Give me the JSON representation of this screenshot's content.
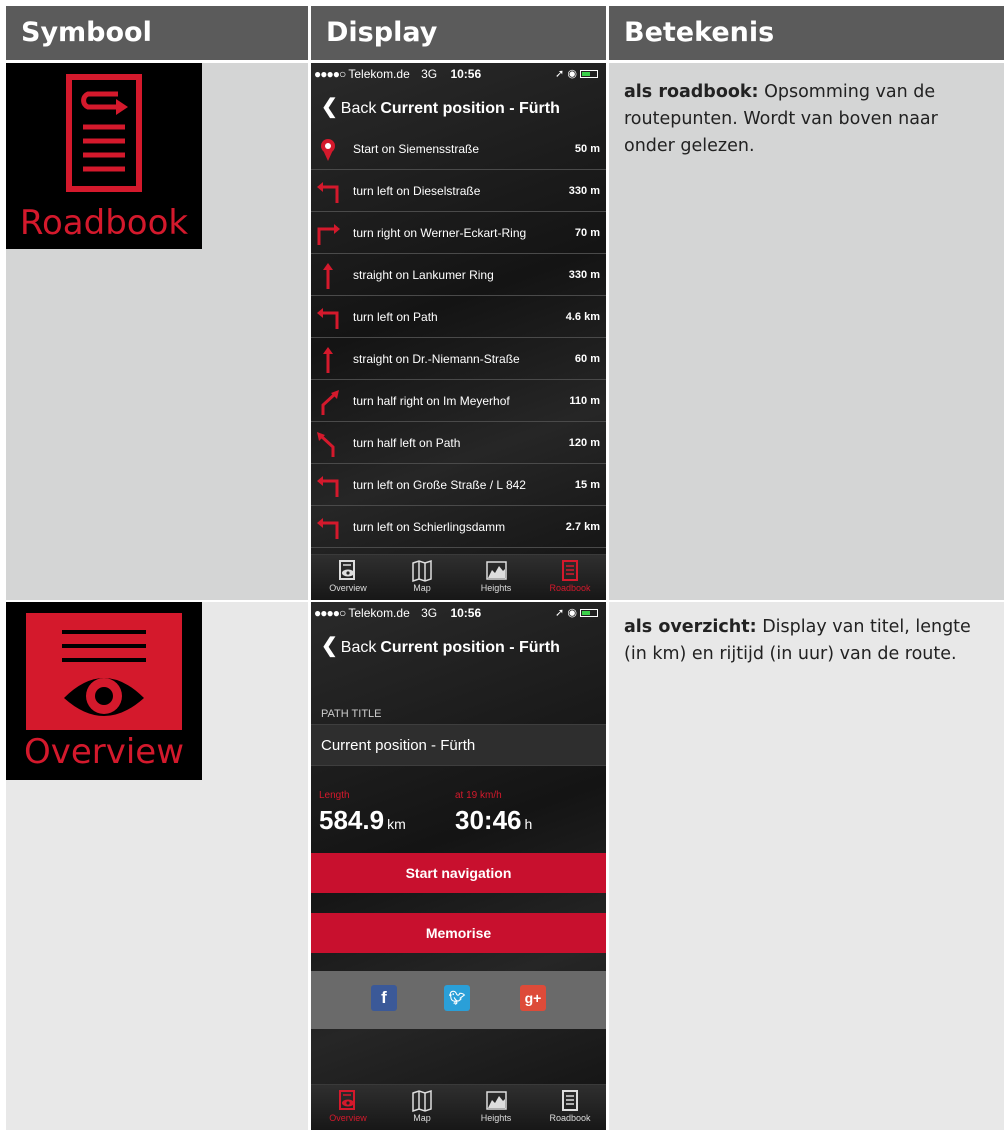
{
  "header": {
    "col1": "Symbool",
    "col2": "Display",
    "col3": "Betekenis"
  },
  "colors": {
    "accent": "#d4192c",
    "header_bg": "#5b5b5b"
  },
  "rows": [
    {
      "symbol_label": "Roadbook",
      "symbol_icon": "roadbook-icon",
      "desc_bold": "als roadbook:",
      "desc_text": " Opsomming van de routepunten. Wordt van boven naar onder gelezen.",
      "phone": {
        "status": {
          "carrier": "Telekom.de",
          "network": "3G",
          "time": "10:56"
        },
        "nav": {
          "back": "Back",
          "title": "Current position - Fürth"
        },
        "steps": [
          {
            "icon": "start-pin-icon",
            "text": "Start on Siemensstraße",
            "dist": "50 m"
          },
          {
            "icon": "turn-left-icon",
            "text": "turn left on Dieselstraße",
            "dist": "330 m"
          },
          {
            "icon": "turn-right-icon",
            "text": "turn right on Werner-Eckart-Ring",
            "dist": "70 m"
          },
          {
            "icon": "straight-icon",
            "text": "straight on Lankumer Ring",
            "dist": "330 m"
          },
          {
            "icon": "turn-left-icon",
            "text": "turn left on Path",
            "dist": "4.6 km"
          },
          {
            "icon": "straight-icon",
            "text": "straight on Dr.-Niemann-Straße",
            "dist": "60 m"
          },
          {
            "icon": "half-right-icon",
            "text": "turn half right on Im Meyerhof",
            "dist": "110 m"
          },
          {
            "icon": "half-left-icon",
            "text": "turn half left on Path",
            "dist": "120 m"
          },
          {
            "icon": "turn-left-icon",
            "text": "turn left on Große Straße / L 842",
            "dist": "15 m"
          },
          {
            "icon": "turn-left-icon",
            "text": "turn left on Schierlingsdamm",
            "dist": "2.7 km"
          }
        ],
        "tabs": [
          "Overview",
          "Map",
          "Heights",
          "Roadbook"
        ],
        "active_tab": "Roadbook"
      }
    },
    {
      "symbol_label": "Overview",
      "symbol_icon": "overview-icon",
      "desc_bold": "als overzicht:",
      "desc_text": " Display  van titel, lengte (in km) en rijtijd (in uur) van de route.",
      "phone": {
        "status": {
          "carrier": "Telekom.de",
          "network": "3G",
          "time": "10:56"
        },
        "nav": {
          "back": "Back",
          "title": "Current position - Fürth"
        },
        "path_title_label": "PATH TITLE",
        "path_title": "Current position - Fürth",
        "length_label": "Length",
        "length_value": "584.9",
        "length_unit": "km",
        "speed_label": "at 19 km/h",
        "time_value": "30:46",
        "time_unit": "h",
        "start_button": "Start navigation",
        "memorise_button": "Memorise",
        "share": [
          "facebook-icon",
          "twitter-icon",
          "googleplus-icon"
        ],
        "tabs": [
          "Overview",
          "Map",
          "Heights",
          "Roadbook"
        ],
        "active_tab": "Overview"
      }
    }
  ]
}
